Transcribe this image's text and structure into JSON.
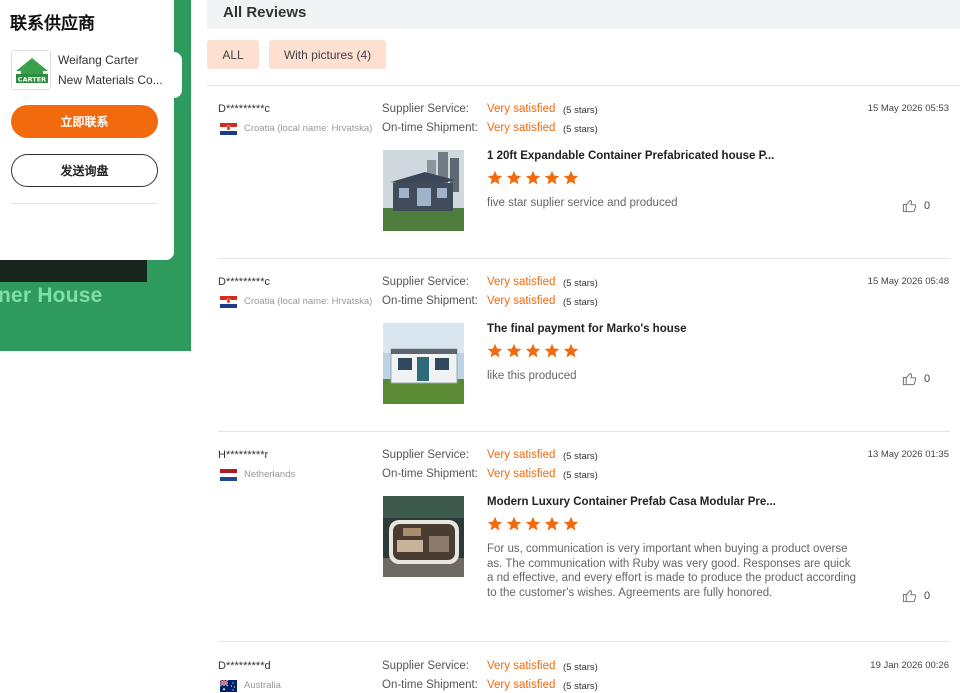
{
  "supplier": {
    "title": "联系供应商",
    "logo_text": "CARTER",
    "company_line1": "Weifang Carter",
    "company_line2": "New Materials Co...",
    "contact_button": "立即联系",
    "inquiry_button": "发送询盘"
  },
  "banner": {
    "text": "ner House"
  },
  "reviews_section": {
    "title": "All Reviews",
    "filters": [
      "ALL",
      "With pictures (4)"
    ]
  },
  "colors": {
    "accent": "#f26a0e",
    "filter_bg": "#fde0cf",
    "banner_green": "#2f9a5e"
  },
  "reviews": [
    {
      "user": "D*********c",
      "country": "Croatia (local name: Hrvatska)",
      "flag": "croatia-flag",
      "supplier_service_label": "Supplier Service:",
      "supplier_service_value": "Very satisfied",
      "supplier_service_stars": "(5 stars)",
      "shipment_label": "On-time Shipment:",
      "shipment_value": "Very satisfied",
      "shipment_stars": "(5 stars)",
      "date": "15 May 2026 05:53",
      "product_title": "1 20ft Expandable Container Prefabricated house P...",
      "rating": 5,
      "text": "five star suplier service and produced",
      "likes": "0"
    },
    {
      "user": "D*********c",
      "country": "Croatia (local name: Hrvatska)",
      "flag": "croatia-flag",
      "supplier_service_label": "Supplier Service:",
      "supplier_service_value": "Very satisfied",
      "supplier_service_stars": "(5 stars)",
      "shipment_label": "On-time Shipment:",
      "shipment_value": "Very satisfied",
      "shipment_stars": "(5 stars)",
      "date": "15 May 2026 05:48",
      "product_title": "The final payment for Marko's house",
      "rating": 5,
      "text": "like this produced",
      "likes": "0"
    },
    {
      "user": "H*********r",
      "country": "Netherlands",
      "flag": "netherlands-flag",
      "supplier_service_label": "Supplier Service:",
      "supplier_service_value": "Very satisfied",
      "supplier_service_stars": "(5 stars)",
      "shipment_label": "On-time Shipment:",
      "shipment_value": "Very satisfied",
      "shipment_stars": "(5 stars)",
      "date": "13 May 2026 01:35",
      "product_title": "Modern Luxury Container Prefab Casa Modular Pre...",
      "rating": 5,
      "text": "For us, communication is very important when buying a product overse as. The communication with Ruby was very good. Responses are quick a nd effective, and every effort is made to produce the product according to the customer's wishes. Agreements are fully honored.",
      "likes": "0"
    },
    {
      "user": "D*********d",
      "country": "Australia",
      "flag": "australia-flag",
      "supplier_service_label": "Supplier Service:",
      "supplier_service_value": "Very satisfied",
      "supplier_service_stars": "(5 stars)",
      "shipment_label": "On-time Shipment:",
      "shipment_value": "Very satisfied",
      "shipment_stars": "(5 stars)",
      "date": "19 Jan 2026 00:26"
    }
  ]
}
